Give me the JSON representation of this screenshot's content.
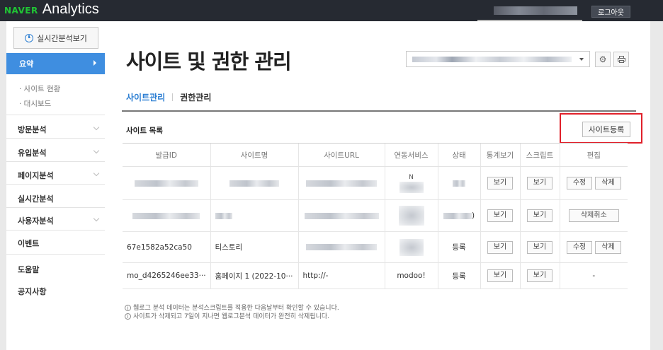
{
  "header": {
    "brand_naver": "NAVER",
    "brand_product": "Analytics",
    "logout_label": "로그아웃"
  },
  "sidebar": {
    "realtime_button": "실시간분석보기",
    "active_item": "요약",
    "sub_items": [
      "· 사이트 현황",
      "· 대시보드"
    ],
    "items": [
      {
        "label": "방문분석",
        "expandable": true
      },
      {
        "label": "유입분석",
        "expandable": true
      },
      {
        "label": "페이지분석",
        "expandable": true
      },
      {
        "label": "실시간분석",
        "expandable": false
      },
      {
        "label": "사용자분석",
        "expandable": true
      },
      {
        "label": "이벤트",
        "expandable": false
      }
    ],
    "footer_items": [
      "도움말",
      "공지사항"
    ]
  },
  "main": {
    "title": "사이트 및 권한 관리",
    "tabs": [
      {
        "label": "사이트관리",
        "active": true
      },
      {
        "label": "권한관리",
        "active": false
      }
    ],
    "section_title": "사이트 목록",
    "register_button": "사이트등록",
    "table": {
      "columns": [
        "발급ID",
        "사이트명",
        "사이트URL",
        "연동서비스",
        "상태",
        "통계보기",
        "스크립트",
        "편집"
      ],
      "rows": [
        {
          "id": "",
          "name": "",
          "url": "",
          "service": "N",
          "status": "",
          "stats": "보기",
          "script": "보기",
          "edit": [
            "수정",
            "삭제"
          ]
        },
        {
          "id": "",
          "name": "",
          "url": "",
          "service": "",
          "status": ")",
          "stats": "보기",
          "script": "보기",
          "edit": [
            "삭제취소"
          ]
        },
        {
          "id": "67e1582a52ca50",
          "name": "티스토리",
          "url": "",
          "service": "",
          "status": "등록",
          "stats": "보기",
          "script": "보기",
          "edit": [
            "수정",
            "삭제"
          ]
        },
        {
          "id": "mo_d4265246ee33···",
          "name": "홈페이지 1 (2022-10···",
          "url": "http://-",
          "service": "modoo!",
          "status": "등록",
          "stats": "보기",
          "script": "보기",
          "edit": [
            "-"
          ]
        }
      ]
    },
    "notes": [
      "웹로그 분석 데이터는 분석스크립트를 적용한 다음날부터 확인할 수 있습니다.",
      "사이트가 삭제되고 7일이 지나면 웹로그분석 데이터가 완전히 삭제됩니다."
    ]
  },
  "colors": {
    "topbar": "#262a32",
    "brand_green": "#20c635",
    "accent_blue": "#3f8ee0",
    "highlight_red": "#e0202a"
  }
}
